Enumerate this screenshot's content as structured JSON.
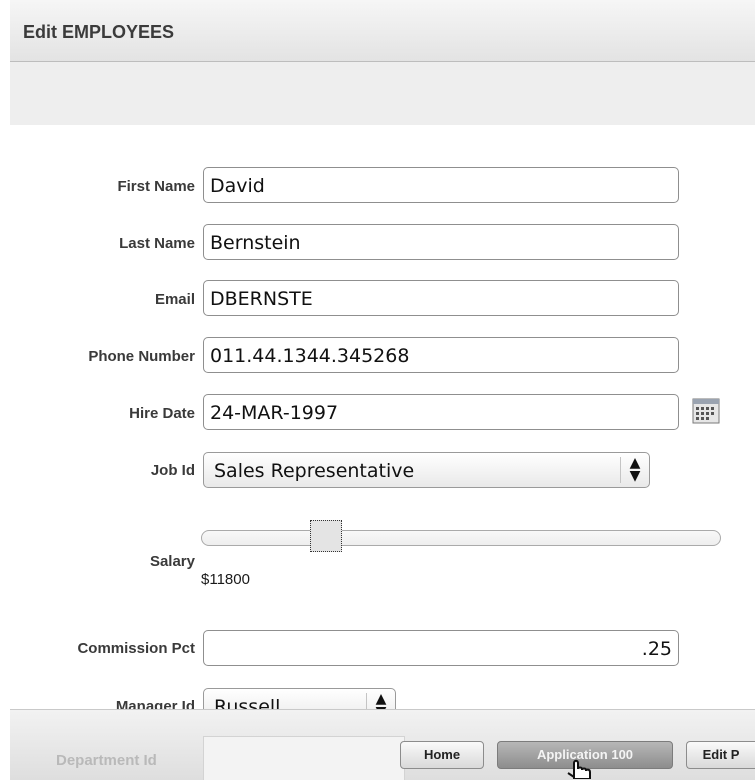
{
  "header": {
    "title": "Edit EMPLOYEES"
  },
  "form": {
    "first_name": {
      "label": "First Name",
      "value": "David"
    },
    "last_name": {
      "label": "Last Name",
      "value": "Bernstein"
    },
    "email": {
      "label": "Email",
      "value": "DBERNSTE"
    },
    "phone_number": {
      "label": "Phone Number",
      "value": "011.44.1344.345268"
    },
    "hire_date": {
      "label": "Hire Date",
      "value": "24-MAR-1997",
      "picker_icon": "calendar-icon"
    },
    "job_id": {
      "label": "Job Id",
      "value": "Sales Representative"
    },
    "salary": {
      "label": "Salary",
      "display": "$11800"
    },
    "commission_pct": {
      "label": "Commission Pct",
      "value": ".25"
    },
    "manager_id": {
      "label": "Manager Id",
      "value": "Russell"
    },
    "department_id": {
      "label": "Department Id",
      "value": ""
    }
  },
  "footer_buttons": {
    "home": "Home",
    "application": "Application 100",
    "edit_page": "Edit P"
  },
  "icons": {
    "select_arrows": "select-arrows-icon",
    "pointer": "hand-pointer-icon"
  }
}
